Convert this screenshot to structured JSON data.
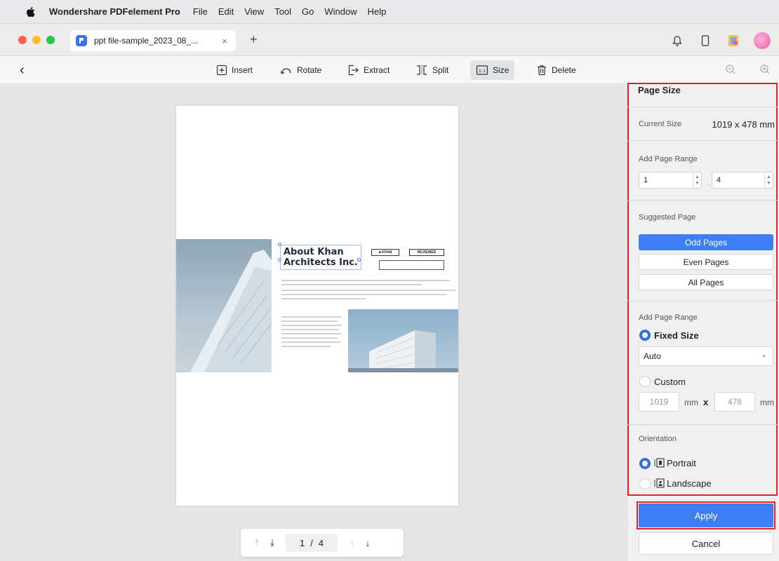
{
  "menubar": {
    "app_name": "Wondershare PDFelement Pro",
    "items": [
      "File",
      "Edit",
      "View",
      "Tool",
      "Go",
      "Window",
      "Help"
    ]
  },
  "tab": {
    "title": "ppt file-sample_2023_08_...",
    "close": "×",
    "add": "+"
  },
  "toolbar": {
    "back": "‹",
    "insert": "Insert",
    "rotate": "Rotate",
    "extract": "Extract",
    "split": "Split",
    "size": "Size",
    "delete": "Delete"
  },
  "slide": {
    "title_line1": "About Khan",
    "title_line2": "Architects Inc.",
    "badge": "REVIEWED"
  },
  "page_nav": {
    "current": "1",
    "separator": "/",
    "total": "4"
  },
  "panel": {
    "title": "Page Size",
    "current_size_label": "Current Size",
    "current_size_value": "1019 x 478 mm",
    "add_page_range_label": "Add Page Range",
    "range_from": "1",
    "range_to": "4",
    "range_dash": "-",
    "suggested_label": "Suggested Page",
    "odd_pages": "Odd Pages",
    "even_pages": "Even Pages",
    "all_pages": "All Pages",
    "add_page_range_label_2": "Add Page Range",
    "fixed_size": "Fixed Size",
    "fixed_size_selected": true,
    "auto_option": "Auto",
    "custom": "Custom",
    "custom_width": "1019",
    "custom_height": "478",
    "unit": "mm",
    "times": "x",
    "orientation_label": "Orientation",
    "portrait": "Portrait",
    "portrait_selected": true,
    "landscape": "Landscape",
    "apply": "Apply",
    "cancel": "Cancel"
  },
  "colors": {
    "accent": "#3d7ef2",
    "highlight": "#e8202a"
  }
}
